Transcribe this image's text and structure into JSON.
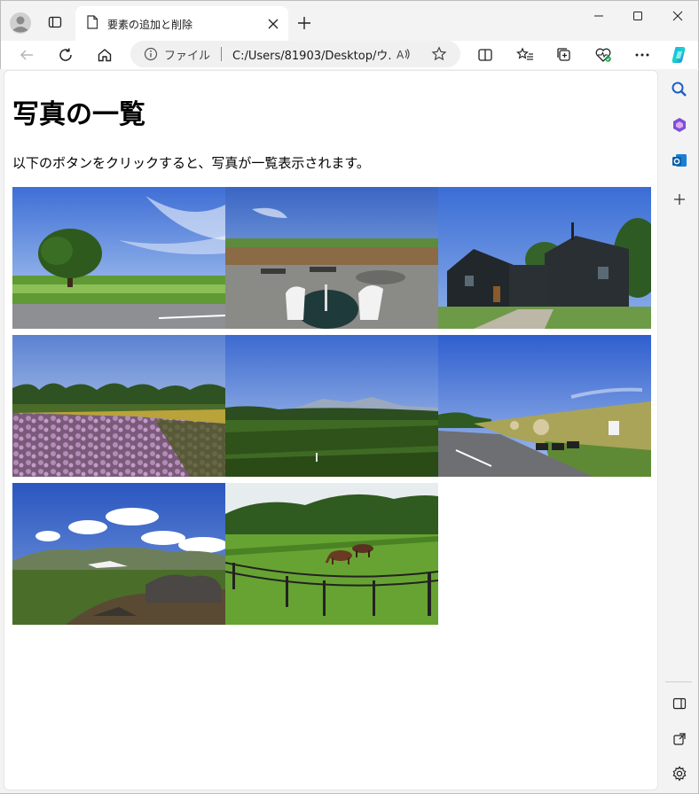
{
  "browser": {
    "tab_title": "要素の追加と削除",
    "address_label": "ファイル",
    "address_url": "C:/Users/81903/Desktop/ウ...",
    "accent_color": "#0078d4"
  },
  "page": {
    "title": "写真の一覧",
    "description": "以下のボタンをクリックすると、写真が一覧表示されます。"
  },
  "photos": [
    {
      "subject": "lone-tree-field"
    },
    {
      "subject": "terrace-table-chairs"
    },
    {
      "subject": "dark-wooden-house"
    },
    {
      "subject": "lavender-field"
    },
    {
      "subject": "green-meadow-mountains"
    },
    {
      "subject": "road-hay-bales"
    },
    {
      "subject": "rocky-mountain-clouds"
    },
    {
      "subject": "horses-pasture"
    }
  ],
  "icons": {
    "profile": "profile-icon",
    "tabs": "tab-actions-icon",
    "tab_page": "page-icon",
    "close": "close-icon",
    "new_tab": "plus-icon",
    "back": "back-arrow-icon",
    "refresh": "refresh-icon",
    "home": "home-icon",
    "info": "info-icon",
    "read_aloud": "read-aloud-icon",
    "favorite": "star-icon",
    "split": "split-screen-icon",
    "favorites": "favorites-list-icon",
    "collections": "collections-icon",
    "health": "browser-essentials-icon",
    "more": "more-icon",
    "copilot": "copilot-icon"
  }
}
